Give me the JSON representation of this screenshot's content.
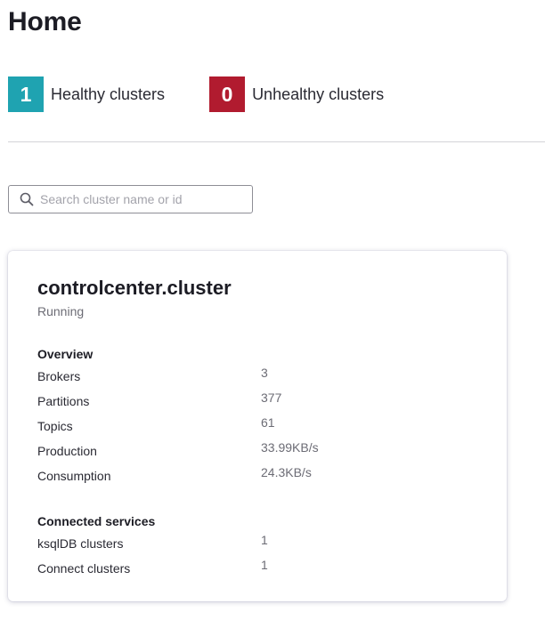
{
  "header": {
    "title": "Home"
  },
  "stats": {
    "healthy": {
      "count": "1",
      "label": "Healthy clusters",
      "color": "#1fa3b1"
    },
    "unhealthy": {
      "count": "0",
      "label": "Unhealthy clusters",
      "color": "#b11b2f"
    }
  },
  "search": {
    "placeholder": "Search cluster name or id",
    "value": ""
  },
  "cluster": {
    "name": "controlcenter.cluster",
    "status": "Running",
    "overview": {
      "heading": "Overview",
      "rows": [
        {
          "label": "Brokers",
          "value": "3"
        },
        {
          "label": "Partitions",
          "value": "377"
        },
        {
          "label": "Topics",
          "value": "61"
        },
        {
          "label": "Production",
          "value": "33.99KB/s"
        },
        {
          "label": "Consumption",
          "value": "24.3KB/s"
        }
      ]
    },
    "services": {
      "heading": "Connected services",
      "rows": [
        {
          "label": "ksqlDB clusters",
          "value": "1"
        },
        {
          "label": "Connect clusters",
          "value": "1"
        }
      ]
    }
  }
}
